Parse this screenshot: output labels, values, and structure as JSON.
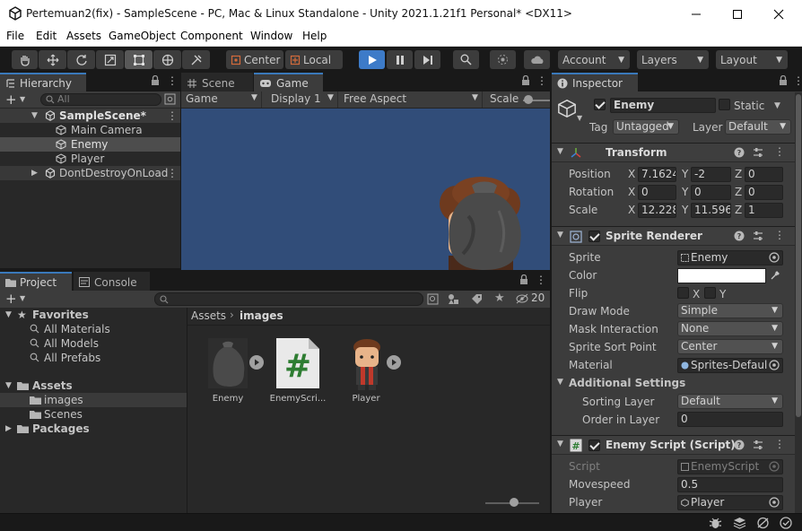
{
  "window": {
    "title": "Pertemuan2(fix) - SampleScene - PC, Mac & Linux Standalone - Unity 2021.1.21f1 Personal* <DX11>",
    "controls": [
      "minimize",
      "maximize",
      "close"
    ]
  },
  "menu": [
    "File",
    "Edit",
    "Assets",
    "GameObject",
    "Component",
    "Window",
    "Help"
  ],
  "toolbar": {
    "pivot_label": "Center",
    "space_label": "Local",
    "account_label": "Account",
    "layers_label": "Layers",
    "layout_label": "Layout",
    "tools": [
      "hand-tool",
      "move-tool",
      "rotate-tool",
      "scale-tool",
      "rect-tool",
      "transform-tool",
      "custom-tool"
    ],
    "playback": [
      "play",
      "pause",
      "step"
    ]
  },
  "hierarchy": {
    "tab": "Hierarchy",
    "search_placeholder": "All",
    "items": [
      {
        "label": "SampleScene*",
        "level": 0
      },
      {
        "label": "Main Camera",
        "level": 1
      },
      {
        "label": "Enemy",
        "level": 1
      },
      {
        "label": "Player",
        "level": 1
      },
      {
        "label": "DontDestroyOnLoad",
        "level": 0
      }
    ]
  },
  "game_view": {
    "tabs": [
      "Scene",
      "Game"
    ],
    "mode_dropdown": "Game",
    "display_dropdown": "Display 1",
    "aspect_dropdown": "Free Aspect",
    "scale_label": "Scale"
  },
  "project": {
    "tabs": [
      "Project",
      "Console"
    ],
    "hidden_count": "20",
    "favorites_label": "Favorites",
    "favorites": [
      "All Materials",
      "All Models",
      "All Prefabs"
    ],
    "assets_label": "Assets",
    "asset_folders": [
      "images",
      "Scenes"
    ],
    "packages_label": "Packages",
    "breadcrumb": [
      "Assets",
      "images"
    ],
    "files": [
      {
        "name": "Enemy",
        "kind": "sprite"
      },
      {
        "name": "EnemyScri...",
        "kind": "script"
      },
      {
        "name": "Player",
        "kind": "sprite"
      }
    ]
  },
  "inspector": {
    "tab": "Inspector",
    "object_name": "Enemy",
    "static_label": "Static",
    "tag_label": "Tag",
    "tag_value": "Untagged",
    "layer_label": "Layer",
    "layer_value": "Default",
    "transform": {
      "header": "Transform",
      "position_label": "Position",
      "rotation_label": "Rotation",
      "scale_label": "Scale",
      "position": {
        "x": "7.1624",
        "y": "-2",
        "z": "0"
      },
      "rotation": {
        "x": "0",
        "y": "0",
        "z": "0"
      },
      "scale": {
        "x": "12.228",
        "y": "11.596",
        "z": "1"
      }
    },
    "sprite_renderer": {
      "header": "Sprite Renderer",
      "sprite_label": "Sprite",
      "sprite_value": "Enemy",
      "color_label": "Color",
      "color_value": "#ffffff",
      "flip_label": "Flip",
      "flip_x": "X",
      "flip_y": "Y",
      "draw_mode_label": "Draw Mode",
      "draw_mode_value": "Simple",
      "mask_label": "Mask Interaction",
      "mask_value": "None",
      "sort_point_label": "Sprite Sort Point",
      "sort_point_value": "Center",
      "material_label": "Material",
      "material_value": "Sprites-Defaul",
      "additional_label": "Additional Settings",
      "sorting_layer_label": "Sorting Layer",
      "sorting_layer_value": "Default",
      "order_label": "Order in Layer",
      "order_value": "0"
    },
    "enemy_script": {
      "header": "Enemy Script (Script)",
      "script_label": "Script",
      "script_value": "EnemyScript",
      "movespeed_label": "Movespeed",
      "movespeed_value": "0.5",
      "player_label": "Player",
      "player_value": "Player"
    }
  },
  "colors": {
    "accent": "#3a79bb",
    "game_bg": "#314d79",
    "panel": "#282828",
    "header": "#3e3e3e",
    "play_active": "#3d7bc8"
  }
}
